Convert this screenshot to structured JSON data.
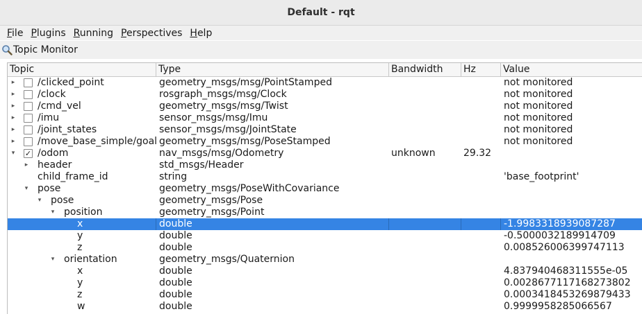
{
  "window": {
    "title": "Default - rqt"
  },
  "menu": [
    {
      "mnemonic": "F",
      "rest": "ile"
    },
    {
      "mnemonic": "P",
      "rest": "lugins"
    },
    {
      "mnemonic": "R",
      "rest": "unning"
    },
    {
      "mnemonic": "P",
      "rest": "erspectives"
    },
    {
      "mnemonic": "H",
      "rest": "elp"
    }
  ],
  "dock": {
    "title": "Topic Monitor",
    "icon": "magnifier-icon"
  },
  "columns": {
    "topic": "Topic",
    "type": "Type",
    "bandwidth": "Bandwidth",
    "hz": "Hz",
    "value": "Value"
  },
  "colors": {
    "selection": "#3584e4"
  },
  "rows": [
    {
      "name": "/clicked_point",
      "type": "geometry_msgs/msg/PointStamped",
      "bw": "",
      "hz": "",
      "value": "not monitored"
    },
    {
      "name": "/clock",
      "type": "rosgraph_msgs/msg/Clock",
      "bw": "",
      "hz": "",
      "value": "not monitored"
    },
    {
      "name": "/cmd_vel",
      "type": "geometry_msgs/msg/Twist",
      "bw": "",
      "hz": "",
      "value": "not monitored"
    },
    {
      "name": "/imu",
      "type": "sensor_msgs/msg/Imu",
      "bw": "",
      "hz": "",
      "value": "not monitored"
    },
    {
      "name": "/joint_states",
      "type": "sensor_msgs/msg/JointState",
      "bw": "",
      "hz": "",
      "value": "not monitored"
    },
    {
      "name": "/move_base_simple/goal",
      "type": "geometry_msgs/msg/PoseStamped",
      "bw": "",
      "hz": "",
      "value": "not monitored"
    },
    {
      "name": "/odom",
      "type": "nav_msgs/msg/Odometry",
      "bw": "unknown",
      "hz": "29.32",
      "value": ""
    },
    {
      "name": "header",
      "type": "std_msgs/Header",
      "bw": "",
      "hz": "",
      "value": ""
    },
    {
      "name": "child_frame_id",
      "type": "string",
      "bw": "",
      "hz": "",
      "value": "'base_footprint'"
    },
    {
      "name": "pose",
      "type": "geometry_msgs/PoseWithCovariance",
      "bw": "",
      "hz": "",
      "value": ""
    },
    {
      "name": "pose",
      "type": "geometry_msgs/Pose",
      "bw": "",
      "hz": "",
      "value": ""
    },
    {
      "name": "position",
      "type": "geometry_msgs/Point",
      "bw": "",
      "hz": "",
      "value": ""
    },
    {
      "name": "x",
      "type": "double",
      "bw": "",
      "hz": "",
      "value": "-1.9983318939087287"
    },
    {
      "name": "y",
      "type": "double",
      "bw": "",
      "hz": "",
      "value": "-0.5000032189914709"
    },
    {
      "name": "z",
      "type": "double",
      "bw": "",
      "hz": "",
      "value": "0.008526006399747113"
    },
    {
      "name": "orientation",
      "type": "geometry_msgs/Quaternion",
      "bw": "",
      "hz": "",
      "value": ""
    },
    {
      "name": "x",
      "type": "double",
      "bw": "",
      "hz": "",
      "value": "4.837940468311555e-05"
    },
    {
      "name": "y",
      "type": "double",
      "bw": "",
      "hz": "",
      "value": "0.0028677117168273802"
    },
    {
      "name": "z",
      "type": "double",
      "bw": "",
      "hz": "",
      "value": "0.0003418453269879433"
    },
    {
      "name": "w",
      "type": "double",
      "bw": "",
      "hz": "",
      "value": "0.9999958285066567"
    }
  ]
}
